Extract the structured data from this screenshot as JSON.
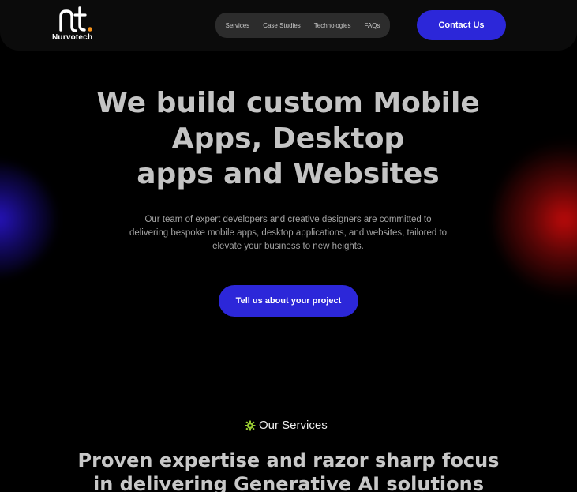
{
  "brand": {
    "name": "Nurvotech",
    "logo_mark": "nt.",
    "accent_color": "#f7941d"
  },
  "nav": {
    "items": [
      {
        "label": "Services"
      },
      {
        "label": "Case Studies"
      },
      {
        "label": "Technologies"
      },
      {
        "label": "FAQs"
      }
    ],
    "contact_label": "Contact Us"
  },
  "hero": {
    "title_lines": [
      "We build custom Mobile",
      "Apps, Desktop",
      "apps and Websites"
    ],
    "description": "Our team of expert developers and creative designers are committed to delivering bespoke mobile apps, desktop applications, and websites, tailored to elevate your business to new heights.",
    "cta_label": "Tell us about your project"
  },
  "services": {
    "label": "Our Services",
    "icon": "gear-icon",
    "heading_lines": [
      "Proven expertise and razor sharp focus",
      "in delivering Generative AI solutions"
    ]
  },
  "colors": {
    "primary_button": "#2c27d9",
    "background": "#000000",
    "icon_green": "#9acd32"
  }
}
